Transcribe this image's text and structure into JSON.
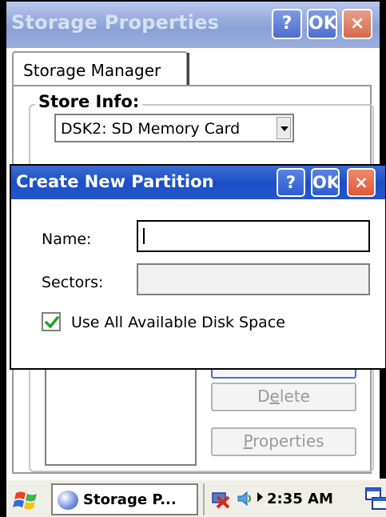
{
  "window": {
    "title": "Storage Properties",
    "help_label": "?",
    "ok_label": "OK",
    "close_label": "×"
  },
  "tabs": [
    {
      "label": "Storage Manager"
    }
  ],
  "store_info": {
    "group_label": "Store Info:",
    "selected_store": "DSK2: SD Memory Card"
  },
  "buttons": {
    "delete_pre": "D",
    "delete_accel": "e",
    "delete_post": "lete",
    "properties_accel": "P",
    "properties_post": "roperties"
  },
  "dialog": {
    "title": "Create New Partition",
    "help_label": "?",
    "ok_label": "OK",
    "close_label": "×",
    "name_label": "Name:",
    "name_value": "",
    "sectors_label": "Sectors:",
    "sectors_value": "",
    "use_all_label": "Use All Available Disk Space",
    "use_all_checked": true
  },
  "taskbar": {
    "task_label": "Storage P...",
    "clock": "2:35 AM",
    "icons": [
      "start-flag-icon",
      "storage-app-icon",
      "network-disconnected-icon",
      "volume-icon",
      "show-desktop-icon"
    ]
  }
}
